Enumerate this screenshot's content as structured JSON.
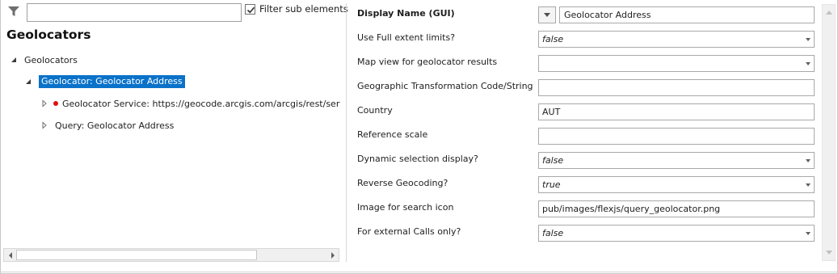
{
  "filter": {
    "input_value": "",
    "checkbox_label": "Filter sub elements",
    "checkbox_checked": true
  },
  "left": {
    "title": "Geolocators",
    "tree": [
      {
        "label": "Geolocators",
        "expanded": true,
        "level": 0
      },
      {
        "label": "Geolocator: Geolocator Address",
        "expanded": true,
        "level": 1,
        "selected": true
      },
      {
        "label": "Geolocator Service: https://geocode.arcgis.com/arcgis/rest/services/",
        "expanded": false,
        "level": 2,
        "status": "error"
      },
      {
        "label": "Query: Geolocator Address",
        "expanded": false,
        "level": 2
      }
    ]
  },
  "properties": {
    "display_name": {
      "label": "Display Name (GUI)",
      "value": "Geolocator Address"
    },
    "rows": [
      {
        "label": "Use Full extent limits?",
        "value": "false",
        "type": "dropdown"
      },
      {
        "label": "Map view for geolocator results",
        "value": "",
        "type": "dropdown"
      },
      {
        "label": "Geographic Transformation Code/String",
        "value": "",
        "type": "text"
      },
      {
        "label": "Country",
        "value": "AUT",
        "type": "text"
      },
      {
        "label": "Reference scale",
        "value": "",
        "type": "text"
      },
      {
        "label": "Dynamic selection display?",
        "value": "false",
        "type": "dropdown"
      },
      {
        "label": "Reverse Geocoding?",
        "value": "true",
        "type": "dropdown"
      },
      {
        "label": "Image for search icon",
        "value": "pub/images/flexjs/query_geolocator.png",
        "type": "text"
      },
      {
        "label": "For external Calls only?",
        "value": "false",
        "type": "dropdown"
      }
    ]
  },
  "colors": {
    "selection": "#0a72c9",
    "error_dot": "#e01010"
  }
}
